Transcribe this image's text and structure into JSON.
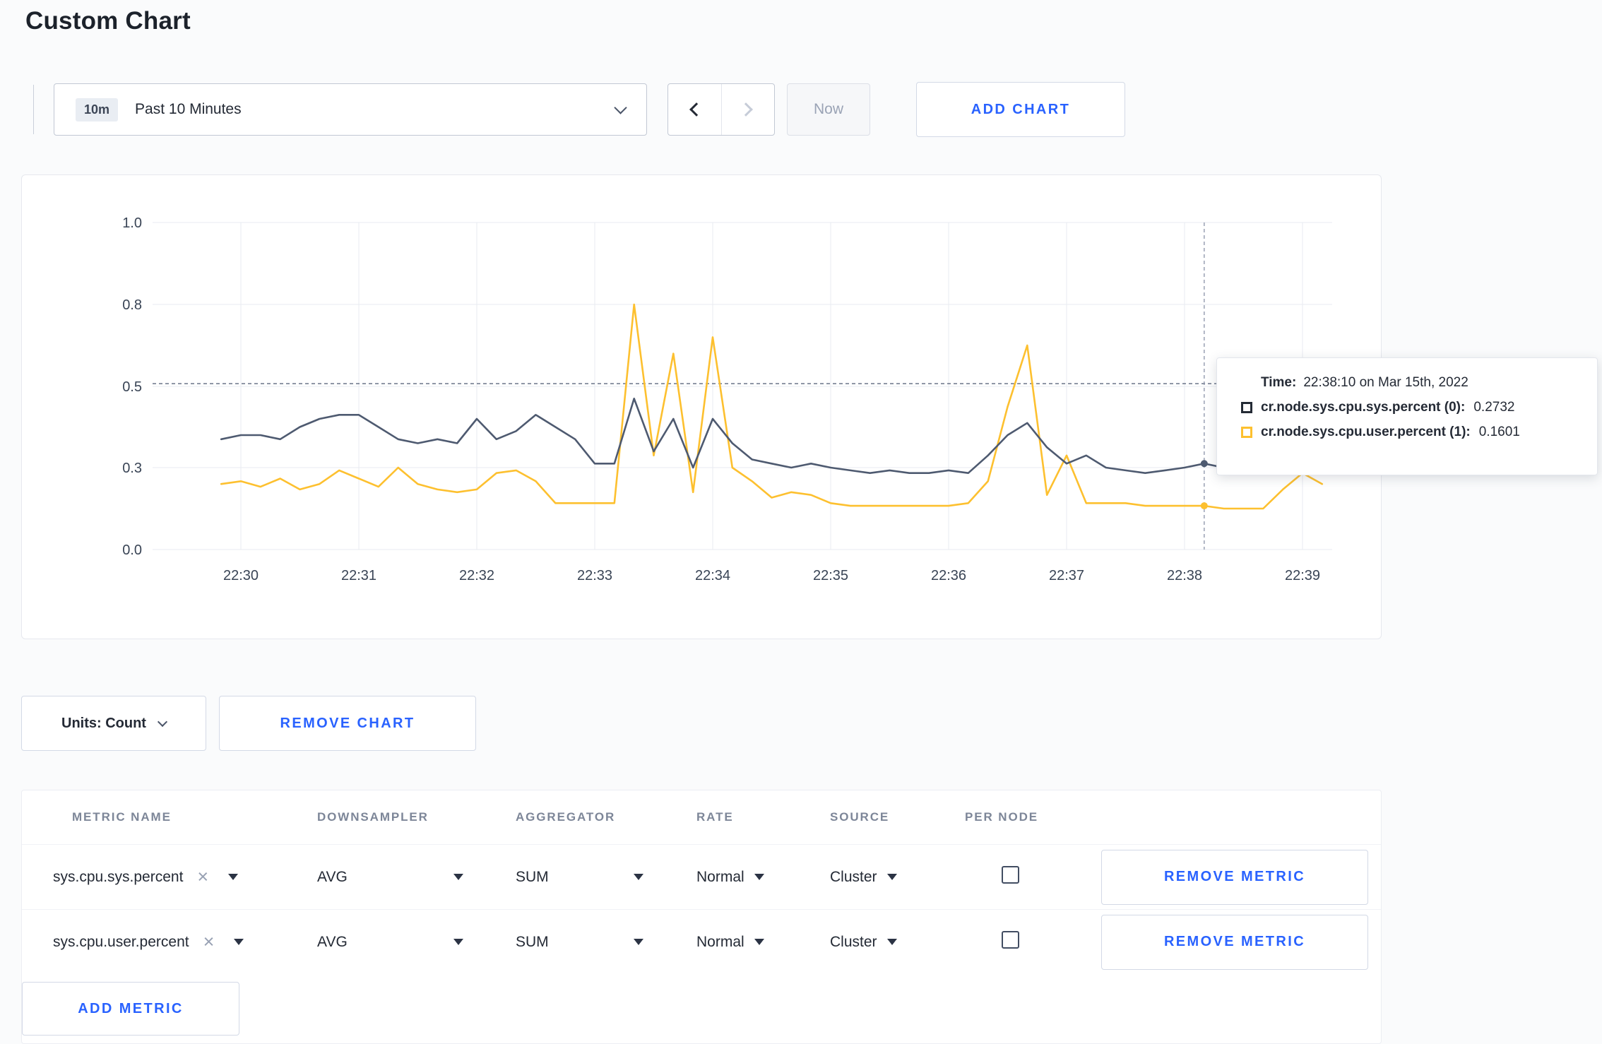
{
  "page": {
    "title": "Custom Chart"
  },
  "toolbar": {
    "range_badge": "10m",
    "range_label": "Past 10 Minutes",
    "now_label": "Now",
    "add_chart_label": "ADD CHART"
  },
  "tooltip": {
    "time_label": "Time:",
    "time_value": "22:38:10 on Mar 15th, 2022",
    "series": [
      {
        "name": "cr.node.sys.cpu.sys.percent (0):",
        "value": "0.2732",
        "color": "#242b35"
      },
      {
        "name": "cr.node.sys.cpu.user.percent (1):",
        "value": "0.1601",
        "color": "#fdc02f"
      }
    ]
  },
  "chart_data": {
    "type": "line",
    "x_tick_labels": [
      "22:30",
      "22:31",
      "22:32",
      "22:33",
      "22:34",
      "22:35",
      "22:36",
      "22:37",
      "22:38",
      "22:39"
    ],
    "y_tick_labels": [
      "0.0",
      "0.3",
      "0.5",
      "0.8",
      "1.0"
    ],
    "y_tick_values": [
      0,
      0.3,
      0.5,
      0.8,
      1.0
    ],
    "start_time": "22:29:50",
    "start_offset_seconds": -10,
    "sample_interval_seconds": 10,
    "crosshair_time": "22:38:10",
    "crosshair_index": 50,
    "hline_value": 0.51,
    "grid": true,
    "series": [
      {
        "name": "cr.node.sys.cpu.sys.percent",
        "color": "#4e5a70",
        "values": [
          0.37,
          0.38,
          0.38,
          0.37,
          0.4,
          0.42,
          0.43,
          0.43,
          0.4,
          0.37,
          0.36,
          0.37,
          0.36,
          0.42,
          0.37,
          0.39,
          0.43,
          0.4,
          0.37,
          0.31,
          0.31,
          0.47,
          0.34,
          0.42,
          0.3,
          0.42,
          0.36,
          0.32,
          0.31,
          0.3,
          0.31,
          0.3,
          0.29,
          0.28,
          0.29,
          0.28,
          0.28,
          0.29,
          0.28,
          0.33,
          0.38,
          0.41,
          0.35,
          0.31,
          0.33,
          0.3,
          0.29,
          0.28,
          0.29,
          0.3,
          0.31,
          0.3,
          0.31,
          0.33,
          0.31,
          0.3,
          0.31
        ]
      },
      {
        "name": "cr.node.sys.cpu.user.percent",
        "color": "#fdc02f",
        "values": [
          0.24,
          0.25,
          0.23,
          0.26,
          0.22,
          0.24,
          0.29,
          0.26,
          0.23,
          0.3,
          0.24,
          0.22,
          0.21,
          0.22,
          0.28,
          0.29,
          0.25,
          0.17,
          0.17,
          0.17,
          0.17,
          0.8,
          0.33,
          0.62,
          0.21,
          0.68,
          0.3,
          0.25,
          0.19,
          0.21,
          0.2,
          0.17,
          0.16,
          0.16,
          0.16,
          0.16,
          0.16,
          0.16,
          0.17,
          0.25,
          0.45,
          0.65,
          0.2,
          0.33,
          0.17,
          0.17,
          0.17,
          0.16,
          0.16,
          0.16,
          0.1601,
          0.15,
          0.15,
          0.15,
          0.22,
          0.28,
          0.24
        ]
      }
    ]
  },
  "units_row": {
    "units_label": "Units: Count",
    "remove_chart_label": "REMOVE CHART"
  },
  "metrics_table": {
    "headers": [
      "METRIC NAME",
      "DOWNSAMPLER",
      "AGGREGATOR",
      "RATE",
      "SOURCE",
      "PER NODE"
    ],
    "rows": [
      {
        "metric": "sys.cpu.sys.percent",
        "downsampler": "AVG",
        "aggregator": "SUM",
        "rate": "Normal",
        "source": "Cluster",
        "per_node_checked": false,
        "remove_label": "REMOVE METRIC"
      },
      {
        "metric": "sys.cpu.user.percent",
        "downsampler": "AVG",
        "aggregator": "SUM",
        "rate": "Normal",
        "source": "Cluster",
        "per_node_checked": false,
        "remove_label": "REMOVE METRIC"
      }
    ],
    "add_metric_label": "ADD METRIC"
  }
}
